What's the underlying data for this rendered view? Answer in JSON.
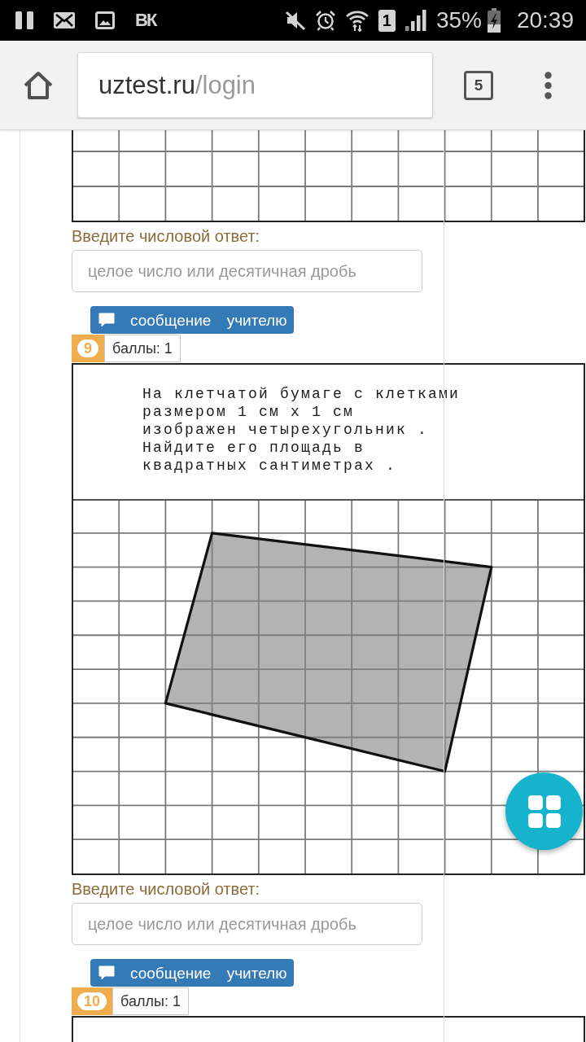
{
  "status_bar": {
    "app_logo": "ВК",
    "sim_slot": "1",
    "battery": "35%",
    "time": "20:39"
  },
  "browser": {
    "url_host": "uztest.ru",
    "url_path": "/login",
    "tab_count": "5"
  },
  "questions": [
    {
      "figure": {
        "kind": "grid"
      },
      "answer": {
        "label": "Введите числовой ответ:",
        "placeholder": "целое число или десятичная дробь"
      }
    },
    {
      "message_button": "сообщение учителю",
      "number": "9",
      "points": "баллы: 1",
      "text": "На клетчатой бумаге с клетками\nразмером 1 см х 1 см\nизображен четырехугольник .\nНайдите его площадь в\nквадратных сантиметрах .",
      "figure": {
        "kind": "quadrilateral"
      },
      "answer": {
        "label": "Введите числовой ответ:",
        "placeholder": "целое число или десятичная дробь"
      }
    },
    {
      "message_button": "сообщение учителю",
      "number": "10",
      "points": "баллы: 1"
    }
  ]
}
